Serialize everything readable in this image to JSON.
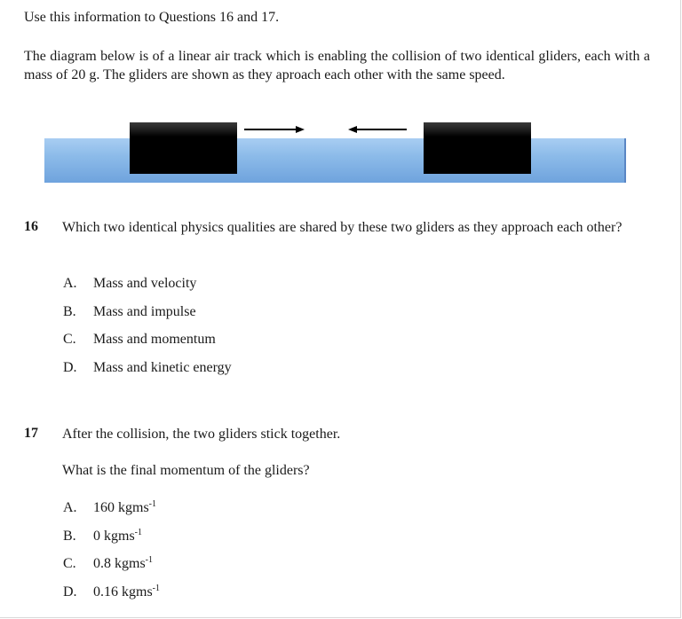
{
  "intro": "Use this information to Questions 16 and 17.",
  "description": "The diagram below is of a linear air track which is enabling the collision of two identical gliders, each with a mass of 20 g. The gliders are shown as they aproach each other with the same speed.",
  "diagram": {
    "track_color": "#8cbbe9",
    "glider_color": "#000000",
    "arrow_left_glider": "right-arrow",
    "arrow_right_glider": "left-arrow"
  },
  "q16": {
    "number": "16",
    "text": "Which two identical physics qualities are shared by these two gliders as they approach each other?",
    "options": [
      {
        "letter": "A.",
        "text": "Mass and velocity"
      },
      {
        "letter": "B.",
        "text": "Mass and impulse"
      },
      {
        "letter": "C.",
        "text": "Mass and momentum"
      },
      {
        "letter": "D.",
        "text": "Mass and kinetic energy"
      }
    ]
  },
  "q17": {
    "number": "17",
    "text": "After the collision, the two gliders stick together.",
    "subquestion": "What is the final momentum of the gliders?",
    "unit_base": "kgms",
    "unit_exp": "-1",
    "options": [
      {
        "letter": "A.",
        "value": "160"
      },
      {
        "letter": "B.",
        "value": "0"
      },
      {
        "letter": "C.",
        "value": "0.8"
      },
      {
        "letter": "D.",
        "value": "0.16"
      }
    ]
  }
}
